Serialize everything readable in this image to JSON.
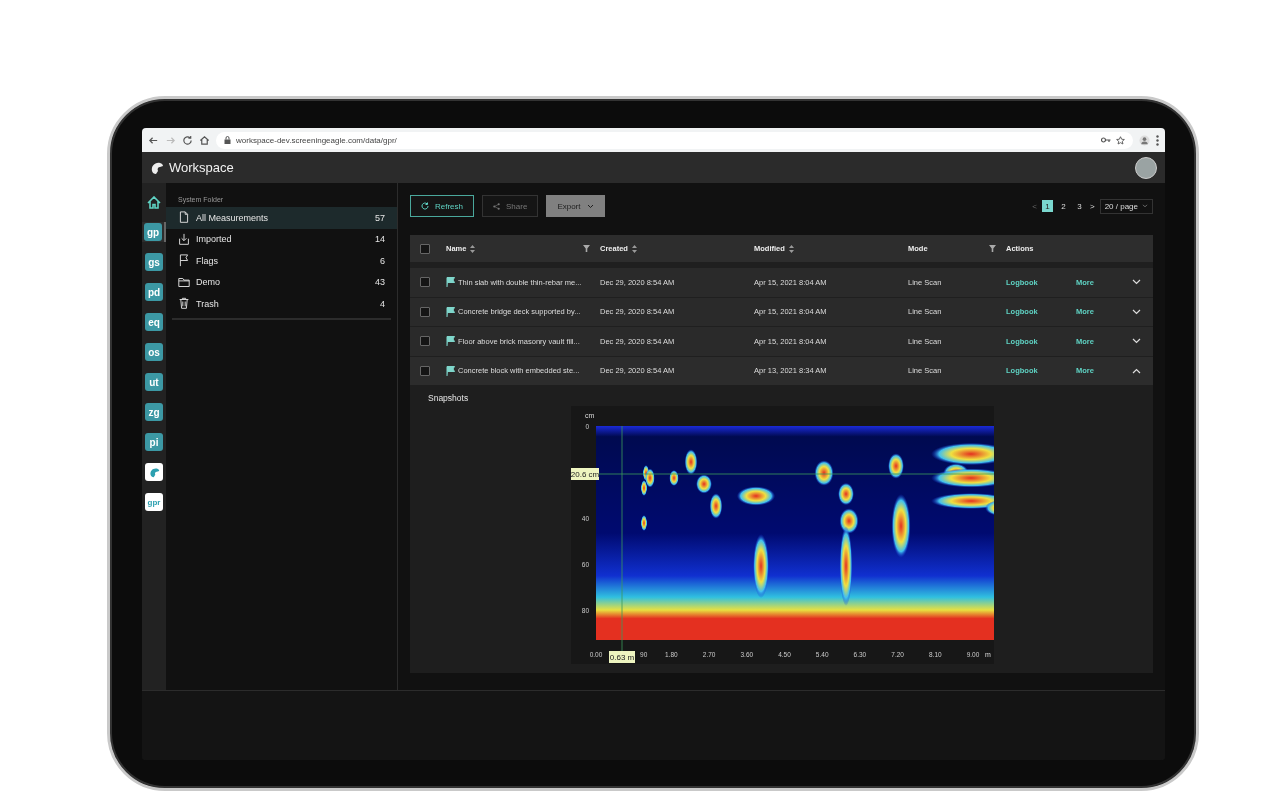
{
  "browser": {
    "url": "workspace-dev.screeningeagle.com/data/gpr/"
  },
  "app": {
    "title": "Workspace"
  },
  "rail": [
    {
      "kind": "home",
      "selected": false
    },
    {
      "kind": "text",
      "label": "gp",
      "selected": true
    },
    {
      "kind": "text",
      "label": "gs",
      "selected": false
    },
    {
      "kind": "text",
      "label": "pd",
      "selected": false
    },
    {
      "kind": "text",
      "label": "eq",
      "selected": false
    },
    {
      "kind": "text",
      "label": "os",
      "selected": false
    },
    {
      "kind": "text",
      "label": "ut",
      "selected": false
    },
    {
      "kind": "text",
      "label": "zg",
      "selected": false
    },
    {
      "kind": "text",
      "label": "pi",
      "selected": false
    },
    {
      "kind": "logo",
      "selected": false
    },
    {
      "kind": "badge",
      "label": "gpr",
      "selected": false
    }
  ],
  "folders": {
    "section": "System Folder",
    "items": [
      {
        "kind": "file",
        "label": "All Measurements",
        "count": "57",
        "selected": true
      },
      {
        "kind": "import",
        "label": "Imported",
        "count": "14",
        "selected": false
      },
      {
        "kind": "flag",
        "label": "Flags",
        "count": "6",
        "selected": false
      },
      {
        "kind": "folder",
        "label": "Demo",
        "count": "43",
        "selected": false
      },
      {
        "kind": "trash",
        "label": "Trash",
        "count": "4",
        "selected": false
      }
    ]
  },
  "toolbar": [
    {
      "kind": "refresh",
      "label": "Refresh",
      "disabled": false
    },
    {
      "kind": "share",
      "label": "Share",
      "disabled": true
    },
    {
      "kind": "export",
      "label": "Export",
      "disabled": true
    }
  ],
  "pagination": {
    "prev": "<",
    "next": ">",
    "pages": [
      {
        "label": "1",
        "selected": true
      },
      {
        "label": "2",
        "selected": false
      },
      {
        "label": "3",
        "selected": false
      }
    ],
    "page_size": "20 / page"
  },
  "table": {
    "select_all_checked": false,
    "columns": [
      {
        "label": "Name",
        "icons": [
          {
            "kind": "sort"
          },
          {
            "kind": "filter"
          }
        ]
      },
      {
        "label": "Created",
        "icons": [
          {
            "kind": "sort"
          }
        ]
      },
      {
        "label": "Modified",
        "icons": [
          {
            "kind": "sort"
          }
        ]
      },
      {
        "label": "Mode",
        "icons": [
          {
            "kind": "filter"
          }
        ]
      },
      {
        "label": "Actions"
      }
    ],
    "rows": [
      {
        "checked": false,
        "flagged": true,
        "name": "Thin slab with double thin-rebar me...",
        "created": "Dec 29, 2020 8:54 AM",
        "modified": "Apr 15, 2021 8:04 AM",
        "mode": "Line Scan",
        "logbook": "Logbook",
        "more": "More",
        "expanded": false
      },
      {
        "checked": false,
        "flagged": true,
        "name": "Concrete bridge deck supported by...",
        "created": "Dec 29, 2020 8:54 AM",
        "modified": "Apr 15, 2021 8:04 AM",
        "mode": "Line Scan",
        "logbook": "Logbook",
        "more": "More",
        "expanded": false
      },
      {
        "checked": false,
        "flagged": true,
        "name": "Floor above brick masonry vault fill...",
        "created": "Dec 29, 2020 8:54 AM",
        "modified": "Apr 15, 2021 8:04 AM",
        "mode": "Line Scan",
        "logbook": "Logbook",
        "more": "More",
        "expanded": false
      },
      {
        "checked": false,
        "flagged": true,
        "name": "Concrete block with embedded ste...",
        "created": "Dec 29, 2020 8:54 AM",
        "modified": "Apr 13, 2021 8:34 AM",
        "mode": "Line Scan",
        "logbook": "Logbook",
        "more": "More",
        "expanded": true
      }
    ]
  },
  "snapshots": {
    "title": "Snapshots",
    "y_unit": "cm",
    "y_ticks": [
      "0",
      "40",
      "60",
      "80"
    ],
    "x_ticks": [
      "0.00",
      "90",
      "1.80",
      "2.70",
      "3.60",
      "4.50",
      "5.40",
      "6.30",
      "7.20",
      "8.10",
      "9.00"
    ],
    "x_unit": "m",
    "cursor_depth": "20.6 cm",
    "cursor_distance": "0.63 m"
  }
}
